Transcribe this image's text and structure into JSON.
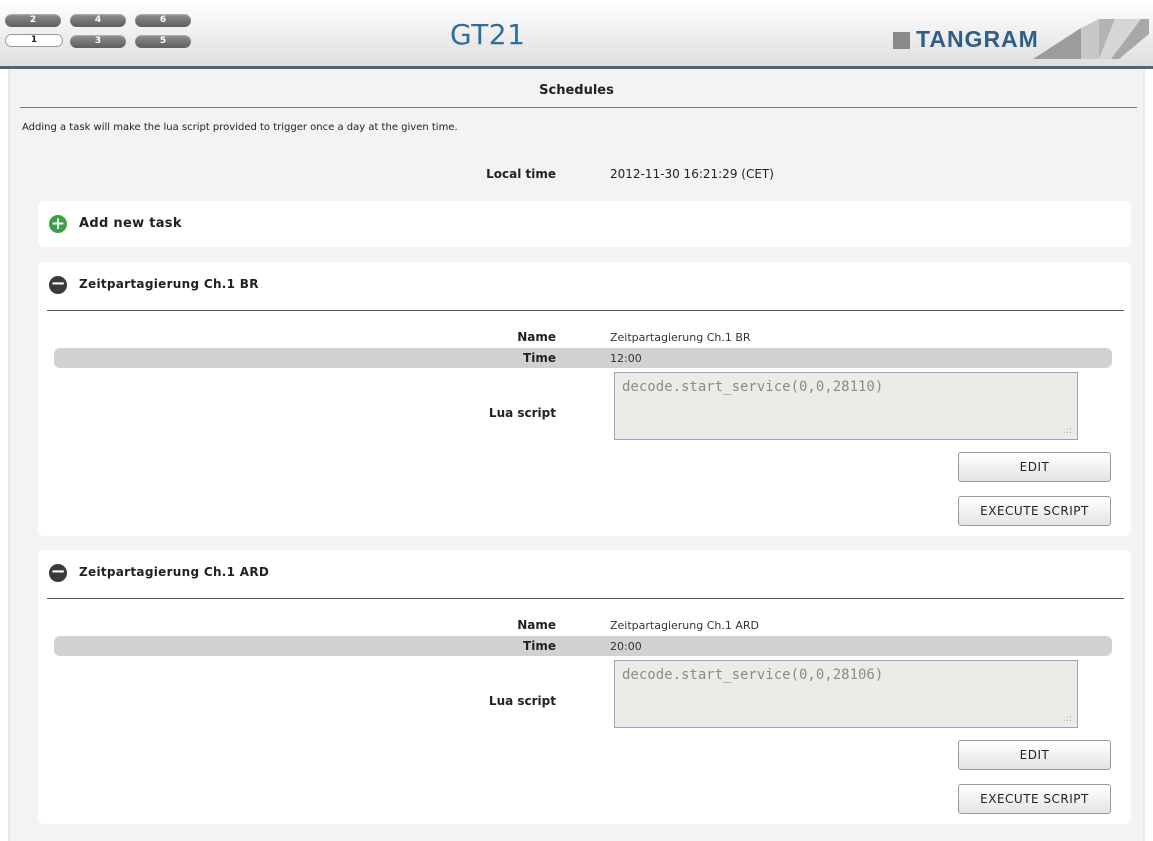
{
  "header": {
    "slots": [
      "2",
      "4",
      "6",
      "1",
      "3",
      "5"
    ],
    "active_slot": "1",
    "device_title": "GT21",
    "logo_text": "TANGRAM"
  },
  "page": {
    "section_title": "Schedules",
    "intro": "Adding a task will make the lua script provided to trigger once a day at the given time.",
    "local_time_label": "Local time",
    "local_time_value": "2012-11-30 16:21:29 (CET)",
    "add_task_label": "Add new task"
  },
  "labels": {
    "name": "Name",
    "time": "Time",
    "lua_script": "Lua script",
    "edit": "EDIT",
    "execute": "EXECUTE SCRIPT",
    "grip": ".::"
  },
  "tasks": [
    {
      "title": "Zeitpartagierung Ch.1 BR",
      "name": "Zeitpartagierung Ch.1 BR",
      "time": "12:00",
      "script": "decode.start_service(0,0,28110)"
    },
    {
      "title": "Zeitpartagierung Ch.1 ARD",
      "name": "Zeitpartagierung Ch.1 ARD",
      "time": "20:00",
      "script": "decode.start_service(0,0,28106)"
    }
  ],
  "icons": {
    "add": "plus-circle-icon",
    "collapse": "minus-circle-icon"
  },
  "colors": {
    "accent_blue": "#2a6f9e",
    "header_border": "#4a6678",
    "add_icon_green": "#3aa14a"
  }
}
